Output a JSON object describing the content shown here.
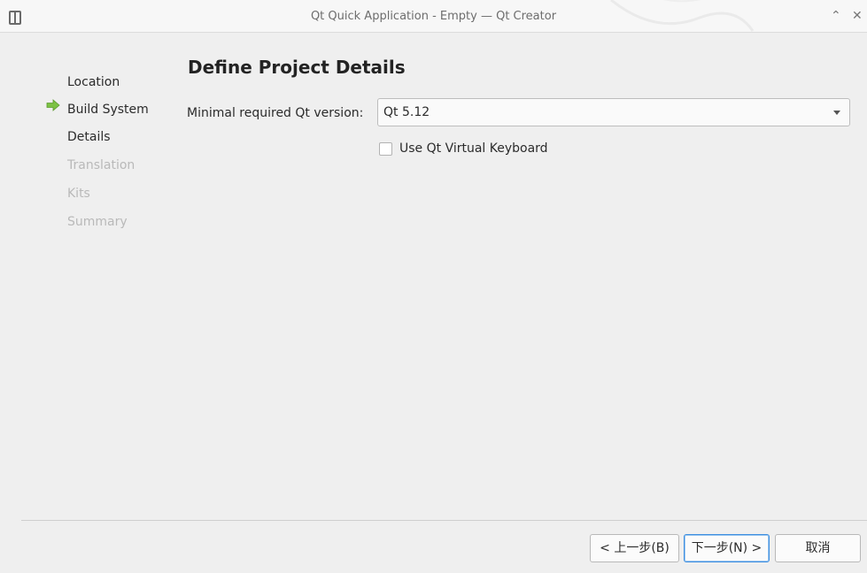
{
  "window": {
    "title": "Qt Quick Application - Empty — Qt Creator"
  },
  "steps": [
    {
      "label": "Location",
      "state": "done"
    },
    {
      "label": "Build System",
      "state": "done"
    },
    {
      "label": "Details",
      "state": "current"
    },
    {
      "label": "Translation",
      "state": "pending"
    },
    {
      "label": "Kits",
      "state": "pending"
    },
    {
      "label": "Summary",
      "state": "pending"
    }
  ],
  "page": {
    "title": "Define Project Details",
    "qt_version_label": "Minimal required Qt version:",
    "qt_version_value": "Qt 5.12",
    "virtual_keyboard_label": "Use Qt Virtual Keyboard",
    "virtual_keyboard_checked": false
  },
  "buttons": {
    "back": "< 上一步(B)",
    "next": "下一步(N) >",
    "cancel": "取消"
  },
  "icons": {
    "app": "window-icon",
    "current_step": "green-arrow-right-icon",
    "collapse": "chevron-up-icon",
    "close": "close-icon"
  },
  "colors": {
    "current_step_arrow": "#7cc243",
    "focus_border": "#3d8ee0"
  }
}
